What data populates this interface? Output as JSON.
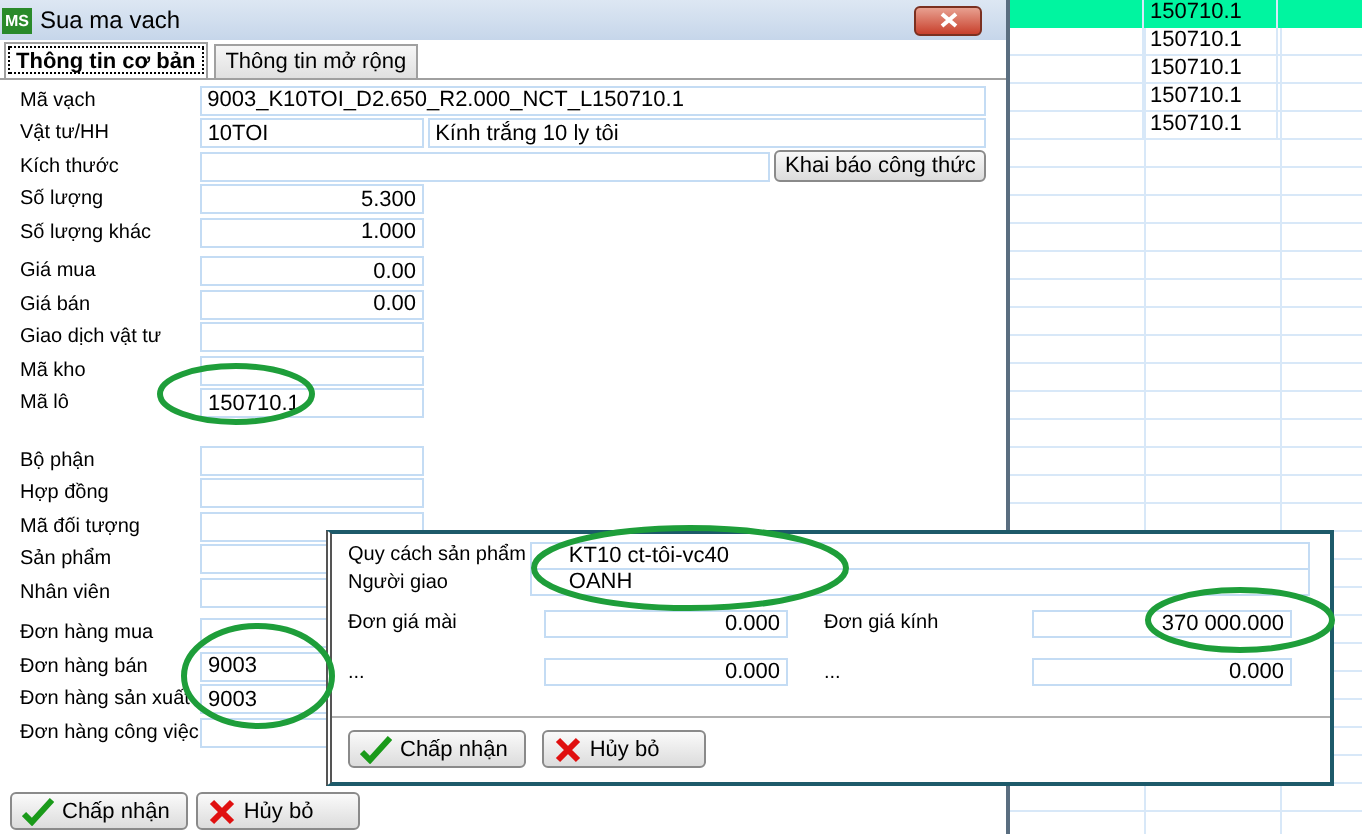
{
  "window": {
    "title": "Sua ma vach",
    "logo": "MS"
  },
  "tabs": [
    {
      "label": "Thông tin cơ bản",
      "selected": true
    },
    {
      "label": "Thông tin mở rộng",
      "selected": false
    }
  ],
  "sections": [
    [
      {
        "kind": "text",
        "label": "Mã vạch",
        "value": "9003_K10TOI_D2.650_R2.000_NCT_L150710.1"
      },
      {
        "kind": "pair",
        "label": "Vật tư/HH",
        "value": "10TOI",
        "value2": "Kính trắng 10 ly tôi"
      },
      {
        "kind": "button",
        "label": "Kích thước",
        "button": "Khai báo công thức"
      },
      {
        "kind": "number",
        "label": "Số lượng",
        "value": "5.300"
      },
      {
        "kind": "number",
        "label": "Số lượng khác",
        "value": "1.000"
      }
    ],
    [
      {
        "kind": "number",
        "label": "Giá mua",
        "value": "0.00"
      },
      {
        "kind": "number",
        "label": "Giá bán",
        "value": "0.00"
      },
      {
        "kind": "short",
        "label": "Giao dịch vật tư"
      },
      {
        "kind": "short",
        "label": "Mã kho"
      },
      {
        "kind": "short",
        "label": "Mã lô",
        "value": "150710.1"
      }
    ],
    [
      {
        "kind": "short",
        "label": "Bộ phận"
      },
      {
        "kind": "short",
        "label": "Hợp đồng"
      },
      {
        "kind": "short",
        "label": "Mã đối tượng"
      },
      {
        "kind": "short",
        "label": "Sản phẩm"
      },
      {
        "kind": "short",
        "label": "Nhân viên"
      }
    ],
    [
      {
        "kind": "short",
        "label": "Đơn hàng mua"
      },
      {
        "kind": "short",
        "label": "Đơn hàng bán",
        "value": "9003"
      },
      {
        "kind": "short",
        "label": "Đơn hàng sản xuất",
        "value": "9003"
      },
      {
        "kind": "short",
        "label": "Đơn hàng công việc"
      }
    ]
  ],
  "buttons": [
    {
      "kind": "ok",
      "label": "Chấp nhận"
    },
    {
      "kind": "cancel",
      "label": "Hủy bỏ"
    }
  ],
  "grid": {
    "rows": [
      {
        "selected": true,
        "value": "150710.1"
      },
      {
        "selected": false,
        "value": "150710.1"
      },
      {
        "selected": false,
        "value": "150710.1"
      },
      {
        "selected": false,
        "value": "150710.1"
      },
      {
        "selected": false,
        "value": "150710.1"
      }
    ]
  },
  "popup": {
    "rows": [
      {
        "kind": "wide",
        "label": "Quy cách sản phẩm",
        "value": "KT10 ct-tôi-vc40"
      },
      {
        "kind": "wide",
        "label": "Người giao",
        "value": "OANH"
      },
      {
        "kind": "pair",
        "cells": [
          {
            "label": "Đơn giá mài",
            "value": "0.000"
          },
          {
            "label": "Đơn giá kính",
            "value": "370 000.000"
          }
        ]
      },
      {
        "kind": "pair",
        "cells": [
          {
            "label": "...",
            "value": "0.000"
          },
          {
            "label": "...",
            "value": "0.000"
          }
        ]
      }
    ],
    "buttons": [
      {
        "kind": "ok",
        "label": "Chấp nhận"
      },
      {
        "kind": "cancel",
        "label": "Hủy bỏ"
      }
    ]
  }
}
